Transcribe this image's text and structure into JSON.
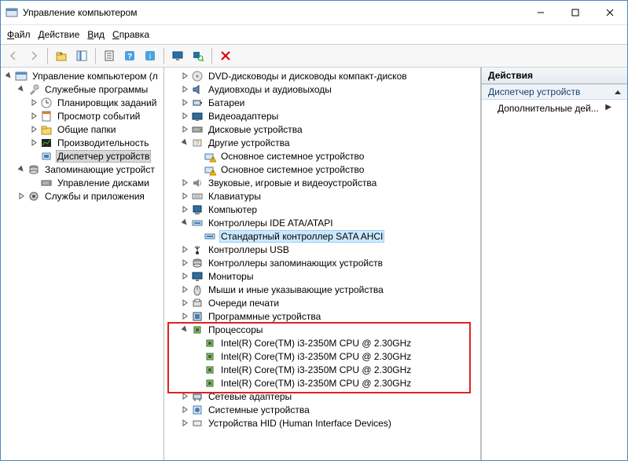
{
  "window": {
    "title": "Управление компьютером"
  },
  "menu": {
    "file": {
      "label": "Файл",
      "u": 0
    },
    "action": {
      "label": "Действие",
      "u": 0
    },
    "view": {
      "label": "Вид",
      "u": 0
    },
    "help": {
      "label": "Справка",
      "u": 0
    }
  },
  "left_tree": {
    "root": {
      "label": "Управление компьютером (л",
      "icon": "console"
    },
    "services_root": {
      "label": "Служебные программы",
      "icon": "tools"
    },
    "services": [
      {
        "label": "Планировщик заданий",
        "icon": "clock",
        "expandable": true
      },
      {
        "label": "Просмотр событий",
        "icon": "event",
        "expandable": true
      },
      {
        "label": "Общие папки",
        "icon": "folder",
        "expandable": true
      },
      {
        "label": "Производительность",
        "icon": "perf",
        "expandable": true
      },
      {
        "label": "Диспетчер устройств",
        "icon": "devmgr",
        "expandable": false,
        "selected": true
      }
    ],
    "storage_root": {
      "label": "Запоминающие устройст",
      "icon": "storage"
    },
    "storage_items": [
      {
        "label": "Управление дисками",
        "icon": "disk"
      }
    ],
    "services_apps": {
      "label": "Службы и приложения",
      "icon": "services"
    }
  },
  "mid_tree": [
    {
      "indent": 1,
      "exp": "closed",
      "icon": "dvd",
      "label": "DVD-дисководы и дисководы компакт-дисков"
    },
    {
      "indent": 1,
      "exp": "closed",
      "icon": "audio",
      "label": "Аудиовходы и аудиовыходы"
    },
    {
      "indent": 1,
      "exp": "closed",
      "icon": "battery",
      "label": "Батареи"
    },
    {
      "indent": 1,
      "exp": "closed",
      "icon": "video",
      "label": "Видеоадаптеры"
    },
    {
      "indent": 1,
      "exp": "closed",
      "icon": "disk",
      "label": "Дисковые устройства"
    },
    {
      "indent": 1,
      "exp": "open",
      "icon": "other",
      "label": "Другие устройства"
    },
    {
      "indent": 2,
      "exp": "none",
      "icon": "warn",
      "label": "Основное системное устройство"
    },
    {
      "indent": 2,
      "exp": "none",
      "icon": "warn",
      "label": "Основное системное устройство"
    },
    {
      "indent": 1,
      "exp": "closed",
      "icon": "sound",
      "label": "Звуковые, игровые и видеоустройства"
    },
    {
      "indent": 1,
      "exp": "closed",
      "icon": "keyboard",
      "label": "Клавиатуры"
    },
    {
      "indent": 1,
      "exp": "closed",
      "icon": "computer",
      "label": "Компьютер"
    },
    {
      "indent": 1,
      "exp": "open",
      "icon": "ide",
      "label": "Контроллеры IDE ATA/ATAPI"
    },
    {
      "indent": 2,
      "exp": "none",
      "icon": "ide",
      "label": "Стандартный контроллер SATA AHCI",
      "selected": true
    },
    {
      "indent": 1,
      "exp": "closed",
      "icon": "usb",
      "label": "Контроллеры USB"
    },
    {
      "indent": 1,
      "exp": "closed",
      "icon": "storage",
      "label": "Контроллеры запоминающих устройств"
    },
    {
      "indent": 1,
      "exp": "closed",
      "icon": "monitor",
      "label": "Мониторы"
    },
    {
      "indent": 1,
      "exp": "closed",
      "icon": "mouse",
      "label": "Мыши и иные указывающие устройства"
    },
    {
      "indent": 1,
      "exp": "closed",
      "icon": "queue",
      "label": "Очереди печати"
    },
    {
      "indent": 1,
      "exp": "closed",
      "icon": "soft",
      "label": "Программные устройства"
    },
    {
      "indent": 1,
      "exp": "open",
      "icon": "cpu",
      "label": "Процессоры",
      "box_start": true
    },
    {
      "indent": 2,
      "exp": "none",
      "icon": "cpu",
      "label": "Intel(R) Core(TM) i3-2350M CPU @ 2.30GHz"
    },
    {
      "indent": 2,
      "exp": "none",
      "icon": "cpu",
      "label": "Intel(R) Core(TM) i3-2350M CPU @ 2.30GHz"
    },
    {
      "indent": 2,
      "exp": "none",
      "icon": "cpu",
      "label": "Intel(R) Core(TM) i3-2350M CPU @ 2.30GHz"
    },
    {
      "indent": 2,
      "exp": "none",
      "icon": "cpu",
      "label": "Intel(R) Core(TM) i3-2350M CPU @ 2.30GHz",
      "box_end": true
    },
    {
      "indent": 1,
      "exp": "closed",
      "icon": "net",
      "label": "Сетевые адаптеры"
    },
    {
      "indent": 1,
      "exp": "closed",
      "icon": "system",
      "label": "Системные устройства"
    },
    {
      "indent": 1,
      "exp": "closed",
      "icon": "hid",
      "label": "Устройства HID (Human Interface Devices)"
    }
  ],
  "actions": {
    "header": "Действия",
    "group": "Диспетчер устройств",
    "more": "Дополнительные дей..."
  }
}
